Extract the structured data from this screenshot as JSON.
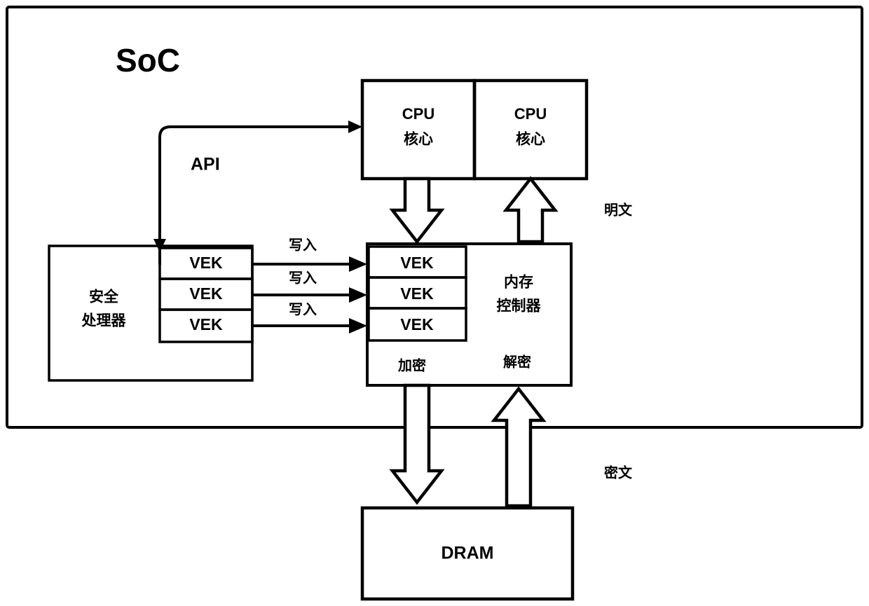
{
  "diagram": {
    "title": "SoC",
    "soc_label": "SoC",
    "api_label": "API",
    "plaintext_label": "明文",
    "ciphertext_label": "密文",
    "write_label": "写入",
    "encrypt_label": "加密",
    "decrypt_label": "解密",
    "cpu": {
      "line1": "CPU",
      "line2": "核心"
    },
    "cpu_cores": [
      {
        "line1": "CPU",
        "line2": "核心"
      },
      {
        "line1": "CPU",
        "line2": "核心"
      }
    ],
    "secure_processor": {
      "line1": "安全",
      "line2": "处理器"
    },
    "memory_controller": {
      "line1": "内存",
      "line2": "控制器"
    },
    "dram_label": "DRAM",
    "vek_label": "VEK",
    "secure_vek_slots": [
      "VEK",
      "VEK",
      "VEK"
    ],
    "mc_vek_slots": [
      "VEK",
      "VEK",
      "VEK"
    ],
    "write_arrows": [
      "写入",
      "写入",
      "写入"
    ],
    "colors": {
      "stroke": "#000000",
      "fill": "#ffffff",
      "background": "#ffffff"
    }
  }
}
